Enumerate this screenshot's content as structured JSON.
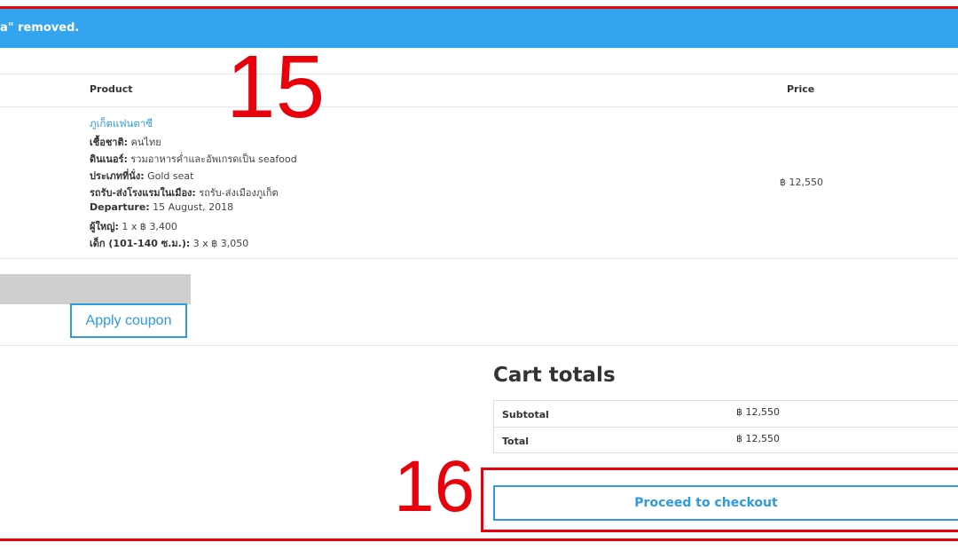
{
  "notice": {
    "text": "a\" removed."
  },
  "cart_table": {
    "headers": {
      "product": "Product",
      "price": "Price"
    },
    "row": {
      "product_name": "ภูเก็ตแฟนตาซี",
      "meta": [
        {
          "key": "เชื้อชาติ:",
          "value": " คนไทย"
        },
        {
          "key": "ดินเนอร์:",
          "value": " รวมอาหารค่ำและอัพเกรดเป็น seafood"
        },
        {
          "key": "ประเภทที่นั่ง:",
          "value": " Gold seat"
        },
        {
          "key": "รถรับ-ส่งโรงแรมในเมือง:",
          "value": " รถรับ-ส่งเมืองภูเก็ต"
        },
        {
          "key": "Departure:",
          "value": " 15 August, 2018"
        },
        {
          "key": "ผู้ใหญ่:",
          "value": " 1 x ฿ 3,400"
        },
        {
          "key": "เด็ก (101-140 ซ.ม.):",
          "value": " 3 x ฿ 3,050"
        }
      ],
      "price": "฿ 12,550"
    }
  },
  "coupon": {
    "placeholder": "",
    "apply_label": "Apply coupon"
  },
  "totals": {
    "title": "Cart totals",
    "subtotal_label": "Subtotal",
    "subtotal_value": "฿ 12,550",
    "total_label": "Total",
    "total_value": "฿ 12,550"
  },
  "checkout": {
    "label": "Proceed to checkout"
  },
  "annotations": {
    "step_a": "15",
    "step_b": "16"
  },
  "colors": {
    "accent": "#2e9ae0",
    "notice_bg": "#33a5f0",
    "annotation_red": "#e8000b"
  }
}
